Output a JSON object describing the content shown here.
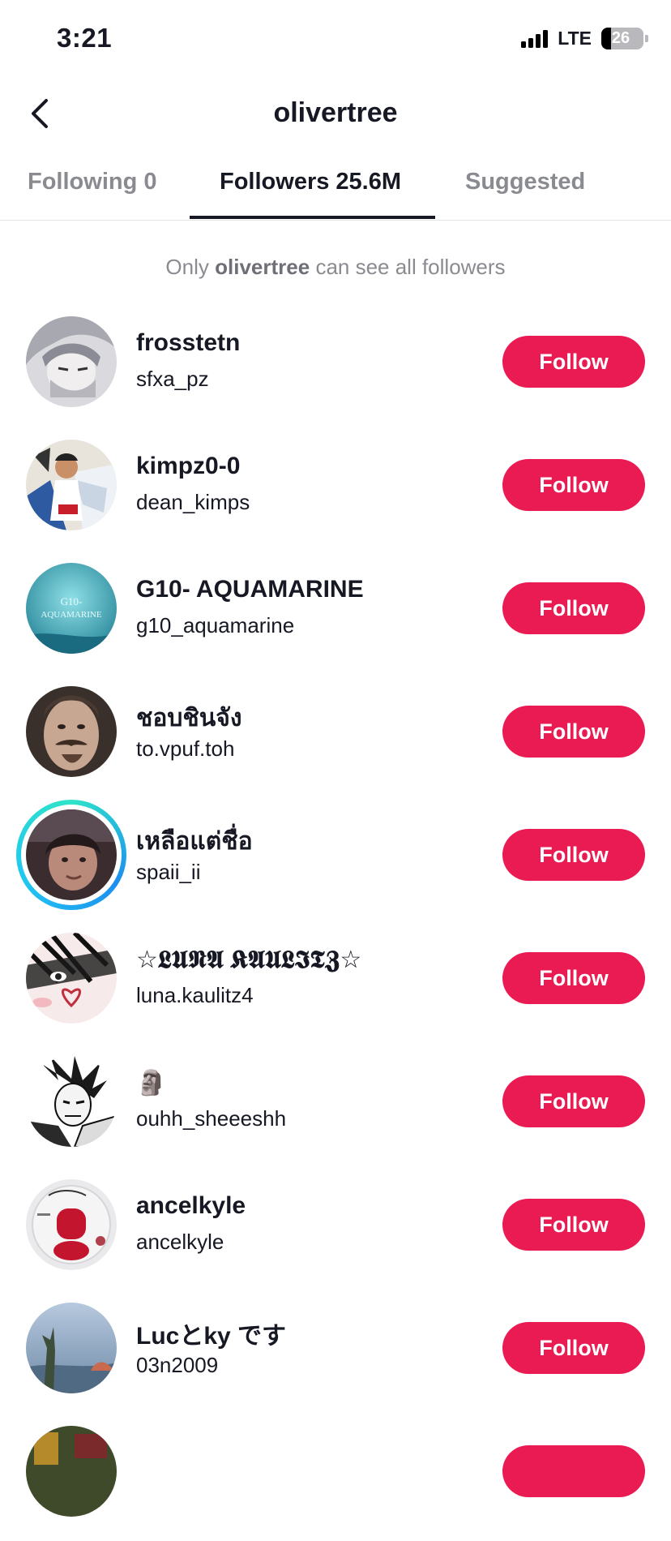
{
  "status_bar": {
    "time": "3:21",
    "network": "LTE",
    "battery": "26"
  },
  "header": {
    "title": "olivertree",
    "back_icon": "chevron-left-icon"
  },
  "tabs": [
    {
      "label": "Following 0",
      "active": false
    },
    {
      "label": "Followers 25.6M",
      "active": true
    },
    {
      "label": "Suggested",
      "active": false
    }
  ],
  "privacy_note": {
    "prefix": "Only",
    "name": "olivertree",
    "suffix": "can see all followers"
  },
  "followers": [
    {
      "display_name": "frosstetn",
      "username": "sfxa_pz",
      "button": "Follow"
    },
    {
      "display_name": "kimpz0-0",
      "username": "dean_kimps",
      "button": "Follow"
    },
    {
      "display_name": "G10- AQUAMARINE",
      "username": "g10_aquamarine",
      "button": "Follow"
    },
    {
      "display_name": "ชอบชินจัง",
      "username": "to.vpuf.toh",
      "button": "Follow"
    },
    {
      "display_name": "เหลือแต่ชื่อ",
      "username": "spaii_ii",
      "button": "Follow"
    },
    {
      "display_name": "☆𝕷𝖀𝕹𝕬 𝕶𝕬𝖀𝕷𝕴𝕿𝖅☆",
      "username": "luna.kaulitz4",
      "button": "Follow"
    },
    {
      "display_name": "🗿",
      "username": "ouhh_sheeeshh",
      "button": "Follow"
    },
    {
      "display_name": "ancelkyle",
      "username": "ancelkyle",
      "button": "Follow"
    },
    {
      "display_name": "Lucとky です",
      "username": "03n2009",
      "button": "Follow"
    }
  ],
  "avatar_text": "G10-\nAQUAMARINE",
  "colors": {
    "follow_button": "#ea1a52",
    "inactive_tab": "#8a8b91",
    "text": "#161823"
  }
}
